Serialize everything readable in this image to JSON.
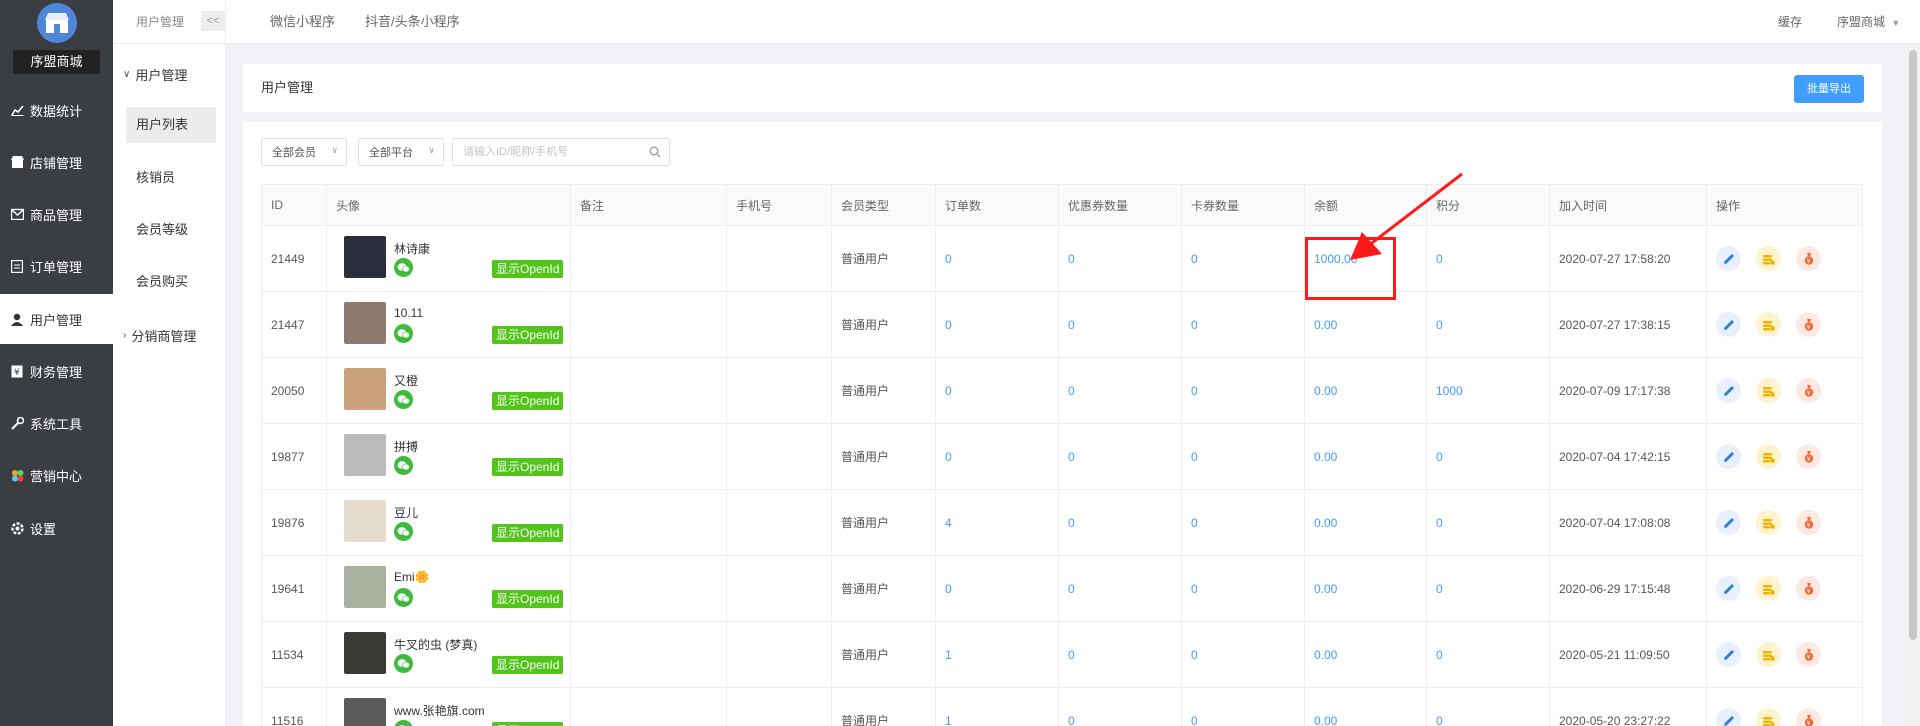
{
  "nav1": {
    "store_name": "序盟商城",
    "items": [
      {
        "label": "数据统计",
        "icon": "chart-icon"
      },
      {
        "label": "店铺管理",
        "icon": "store-icon"
      },
      {
        "label": "商品管理",
        "icon": "goods-icon"
      },
      {
        "label": "订单管理",
        "icon": "order-icon"
      },
      {
        "label": "用户管理",
        "icon": "user-icon",
        "active": true
      },
      {
        "label": "财务管理",
        "icon": "finance-icon"
      },
      {
        "label": "系统工具",
        "icon": "wrench-icon"
      },
      {
        "label": "营销中心",
        "icon": "marketing-icon"
      },
      {
        "label": "设置",
        "icon": "settings-icon"
      }
    ]
  },
  "nav2": {
    "header": "用户管理",
    "collapse": "<<",
    "group1": "用户管理",
    "items": [
      "用户列表",
      "核销员",
      "会员等级",
      "会员购买"
    ],
    "group2": "分销商管理"
  },
  "topbar": {
    "tabs": [
      "微信小程序",
      "抖音/头条小程序"
    ],
    "cache": "缓存",
    "store": "序盟商城"
  },
  "page": {
    "title": "用户管理",
    "export_label": "批量导出"
  },
  "filters": {
    "member": "全部会员",
    "platform": "全部平台",
    "search_placeholder": "请输入ID/昵称/手机号"
  },
  "table": {
    "headers": [
      "ID",
      "头像",
      "备注",
      "手机号",
      "会员类型",
      "订单数",
      "优惠券数量",
      "卡券数量",
      "余额",
      "积分",
      "加入时间",
      "操作"
    ],
    "openid_label": "显示OpenId",
    "rows": [
      {
        "id": "21449",
        "name": "林诗康",
        "remark": "",
        "phone": "",
        "type": "普通用户",
        "orders": "0",
        "coupons": "0",
        "cards": "0",
        "balance": "1000.00",
        "points": "0",
        "joined": "2020-07-27 17:58:20"
      },
      {
        "id": "21447",
        "name": "10.11",
        "remark": "",
        "phone": "",
        "type": "普通用户",
        "orders": "0",
        "coupons": "0",
        "cards": "0",
        "balance": "0.00",
        "points": "0",
        "joined": "2020-07-27 17:38:15"
      },
      {
        "id": "20050",
        "name": "又橙",
        "remark": "",
        "phone": "",
        "type": "普通用户",
        "orders": "0",
        "coupons": "0",
        "cards": "0",
        "balance": "0.00",
        "points": "1000",
        "joined": "2020-07-09 17:17:38"
      },
      {
        "id": "19877",
        "name": "拼搏",
        "remark": "",
        "phone": "",
        "type": "普通用户",
        "orders": "0",
        "coupons": "0",
        "cards": "0",
        "balance": "0.00",
        "points": "0",
        "joined": "2020-07-04 17:42:15"
      },
      {
        "id": "19876",
        "name": "豆儿",
        "remark": "",
        "phone": "",
        "type": "普通用户",
        "orders": "4",
        "coupons": "0",
        "cards": "0",
        "balance": "0.00",
        "points": "0",
        "joined": "2020-07-04 17:08:08"
      },
      {
        "id": "19641",
        "name": "Emi🌼",
        "remark": "",
        "phone": "",
        "type": "普通用户",
        "orders": "0",
        "coupons": "0",
        "cards": "0",
        "balance": "0.00",
        "points": "0",
        "joined": "2020-06-29 17:15:48"
      },
      {
        "id": "11534",
        "name": "牛叉的虫 (梦真)",
        "remark": "",
        "phone": "",
        "type": "普通用户",
        "orders": "1",
        "coupons": "0",
        "cards": "0",
        "balance": "0.00",
        "points": "0",
        "joined": "2020-05-21 11:09:50"
      },
      {
        "id": "11516",
        "name": "www.张艳旗.com",
        "remark": "",
        "phone": "",
        "type": "普通用户",
        "orders": "1",
        "coupons": "0",
        "cards": "0",
        "balance": "0.00",
        "points": "0",
        "joined": "2020-05-20 23:27:22"
      }
    ]
  },
  "colors": {
    "primary": "#409eff",
    "nav_dark": "#3a3d42",
    "openid_green": "#52c41a",
    "wechat_green": "#3dbb3d",
    "annotation_red": "#ff1a1a"
  }
}
